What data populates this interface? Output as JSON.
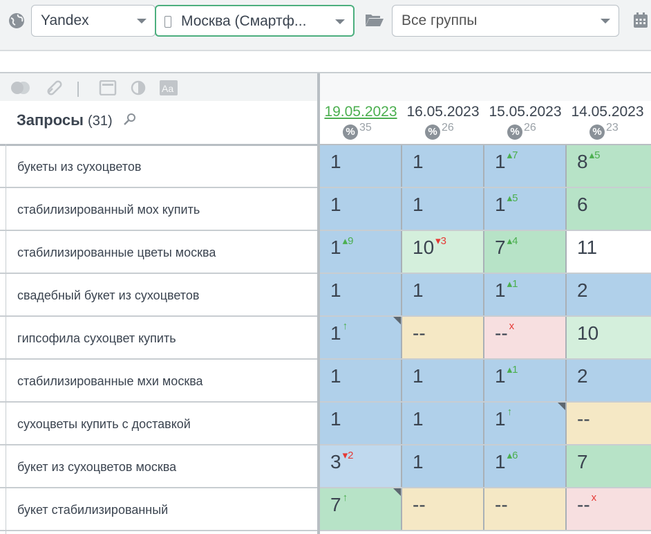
{
  "filters": {
    "engine": "Yandex",
    "region": "Москва (Смартф...",
    "groups": "Все группы"
  },
  "queries_header": {
    "title": "Запросы",
    "count": "(31)"
  },
  "dates": [
    {
      "date": "19.05.2023",
      "pct": "35",
      "active": true
    },
    {
      "date": "16.05.2023",
      "pct": "26",
      "active": false
    },
    {
      "date": "15.05.2023",
      "pct": "26",
      "active": false
    },
    {
      "date": "14.05.2023",
      "pct": "23",
      "active": false
    }
  ],
  "colors": {
    "blue": "#b0d0ea",
    "green": "#b7e3c7",
    "light_green": "#d4efdc",
    "tan": "#f5e8c5",
    "pink": "#f7dfe0",
    "accent_green": "#4caf50",
    "down_red": "#e53935"
  },
  "rows": [
    {
      "query": "букеты из сухоцветов",
      "cells": [
        {
          "v": "1",
          "d": "",
          "c": "blue"
        },
        {
          "v": "1",
          "d": "",
          "c": "blue"
        },
        {
          "v": "1",
          "d": "▴7",
          "dir": "up",
          "c": "blue"
        },
        {
          "v": "8",
          "d": "▴5",
          "dir": "up",
          "c": "green"
        }
      ]
    },
    {
      "query": "стабилизированный мох купить",
      "cells": [
        {
          "v": "1",
          "d": "",
          "c": "blue"
        },
        {
          "v": "1",
          "d": "",
          "c": "blue"
        },
        {
          "v": "1",
          "d": "▴5",
          "dir": "up",
          "c": "blue"
        },
        {
          "v": "6",
          "d": "",
          "c": "green"
        }
      ]
    },
    {
      "query": "стабилизированные цветы москва",
      "cells": [
        {
          "v": "1",
          "d": "▴9",
          "dir": "up",
          "c": "blue"
        },
        {
          "v": "10",
          "d": "▾3",
          "dir": "down",
          "c": "lightgreen"
        },
        {
          "v": "7",
          "d": "▴4",
          "dir": "up",
          "c": "green"
        },
        {
          "v": "11",
          "d": "",
          "c": "white"
        }
      ]
    },
    {
      "query": "свадебный букет из сухоцветов",
      "cells": [
        {
          "v": "1",
          "d": "",
          "c": "blue"
        },
        {
          "v": "1",
          "d": "",
          "c": "blue"
        },
        {
          "v": "1",
          "d": "▴1",
          "dir": "up",
          "c": "blue"
        },
        {
          "v": "2",
          "d": "",
          "c": "blue"
        }
      ]
    },
    {
      "query": "гипсофила сухоцвет купить",
      "cells": [
        {
          "v": "1",
          "d": "↑",
          "dir": "up",
          "c": "blue",
          "corner": true
        },
        {
          "v": "--",
          "d": "",
          "c": "tan"
        },
        {
          "v": "--",
          "d": "x",
          "dir": "down",
          "c": "pink"
        },
        {
          "v": "10",
          "d": "",
          "c": "lightgreen"
        }
      ]
    },
    {
      "query": "стабилизированные мхи москва",
      "cells": [
        {
          "v": "1",
          "d": "",
          "c": "blue"
        },
        {
          "v": "1",
          "d": "",
          "c": "blue"
        },
        {
          "v": "1",
          "d": "▴1",
          "dir": "up",
          "c": "blue"
        },
        {
          "v": "2",
          "d": "",
          "c": "blue"
        }
      ]
    },
    {
      "query": "сухоцветы купить с доставкой",
      "cells": [
        {
          "v": "1",
          "d": "",
          "c": "blue"
        },
        {
          "v": "1",
          "d": "",
          "c": "blue"
        },
        {
          "v": "1",
          "d": "↑",
          "dir": "up",
          "c": "blue",
          "corner": true
        },
        {
          "v": "--",
          "d": "",
          "c": "tan"
        }
      ]
    },
    {
      "query": "букет из сухоцветов москва",
      "cells": [
        {
          "v": "3",
          "d": "▾2",
          "dir": "down",
          "c": "lightblue"
        },
        {
          "v": "1",
          "d": "",
          "c": "blue"
        },
        {
          "v": "1",
          "d": "▴6",
          "dir": "up",
          "c": "blue"
        },
        {
          "v": "7",
          "d": "",
          "c": "green"
        }
      ]
    },
    {
      "query": "букет стабилизированный",
      "cells": [
        {
          "v": "7",
          "d": "↑",
          "dir": "up",
          "c": "green",
          "corner": true
        },
        {
          "v": "--",
          "d": "",
          "c": "tan"
        },
        {
          "v": "--",
          "d": "",
          "c": "tan"
        },
        {
          "v": "--",
          "d": "x",
          "dir": "down",
          "c": "pink"
        }
      ]
    }
  ]
}
